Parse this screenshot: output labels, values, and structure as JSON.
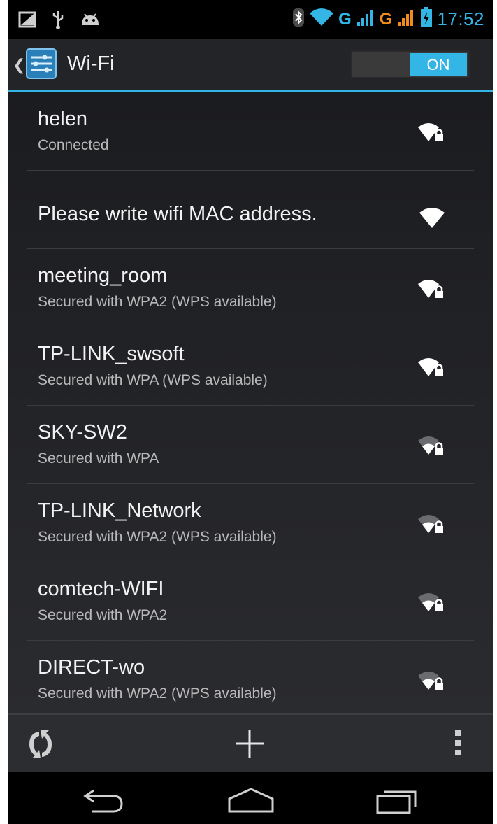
{
  "status_bar": {
    "time": "17:52",
    "network_type_1": "G",
    "network_type_2": "G",
    "icons": [
      "screenshot-icon",
      "usb-icon",
      "android-debug-icon",
      "bluetooth-icon",
      "wifi-status-icon",
      "signal-icon",
      "battery-icon"
    ]
  },
  "action_bar": {
    "title": "Wi-Fi",
    "toggle_label": "ON"
  },
  "networks": [
    {
      "ssid": "helen",
      "status": "Connected",
      "secured": true,
      "signal": 1.0
    },
    {
      "ssid": "Please write wifi MAC address.",
      "status": "",
      "secured": false,
      "signal": 1.0
    },
    {
      "ssid": "meeting_room",
      "status": "Secured with WPA2 (WPS available)",
      "secured": true,
      "signal": 1.0
    },
    {
      "ssid": "TP-LINK_swsoft",
      "status": "Secured with WPA (WPS available)",
      "secured": true,
      "signal": 1.0
    },
    {
      "ssid": "SKY-SW2",
      "status": "Secured with WPA",
      "secured": true,
      "signal": 0.5
    },
    {
      "ssid": "TP-LINK_Network",
      "status": "Secured with WPA2 (WPS available)",
      "secured": true,
      "signal": 0.5
    },
    {
      "ssid": "comtech-WIFI",
      "status": "Secured with WPA2",
      "secured": true,
      "signal": 0.5
    },
    {
      "ssid": "DIRECT-wo",
      "status": "Secured with WPA2 (WPS available)",
      "secured": true,
      "signal": 0.5
    }
  ],
  "bottom_bar": {
    "icons": [
      "wps-push-icon",
      "add-network-icon",
      "overflow-menu-icon"
    ]
  },
  "nav_bar": {
    "icons": [
      "back-icon",
      "home-icon",
      "recents-icon"
    ]
  },
  "colors": {
    "accent": "#33b5e5",
    "signal_orange": "#f08c1e",
    "background": "#111214"
  }
}
